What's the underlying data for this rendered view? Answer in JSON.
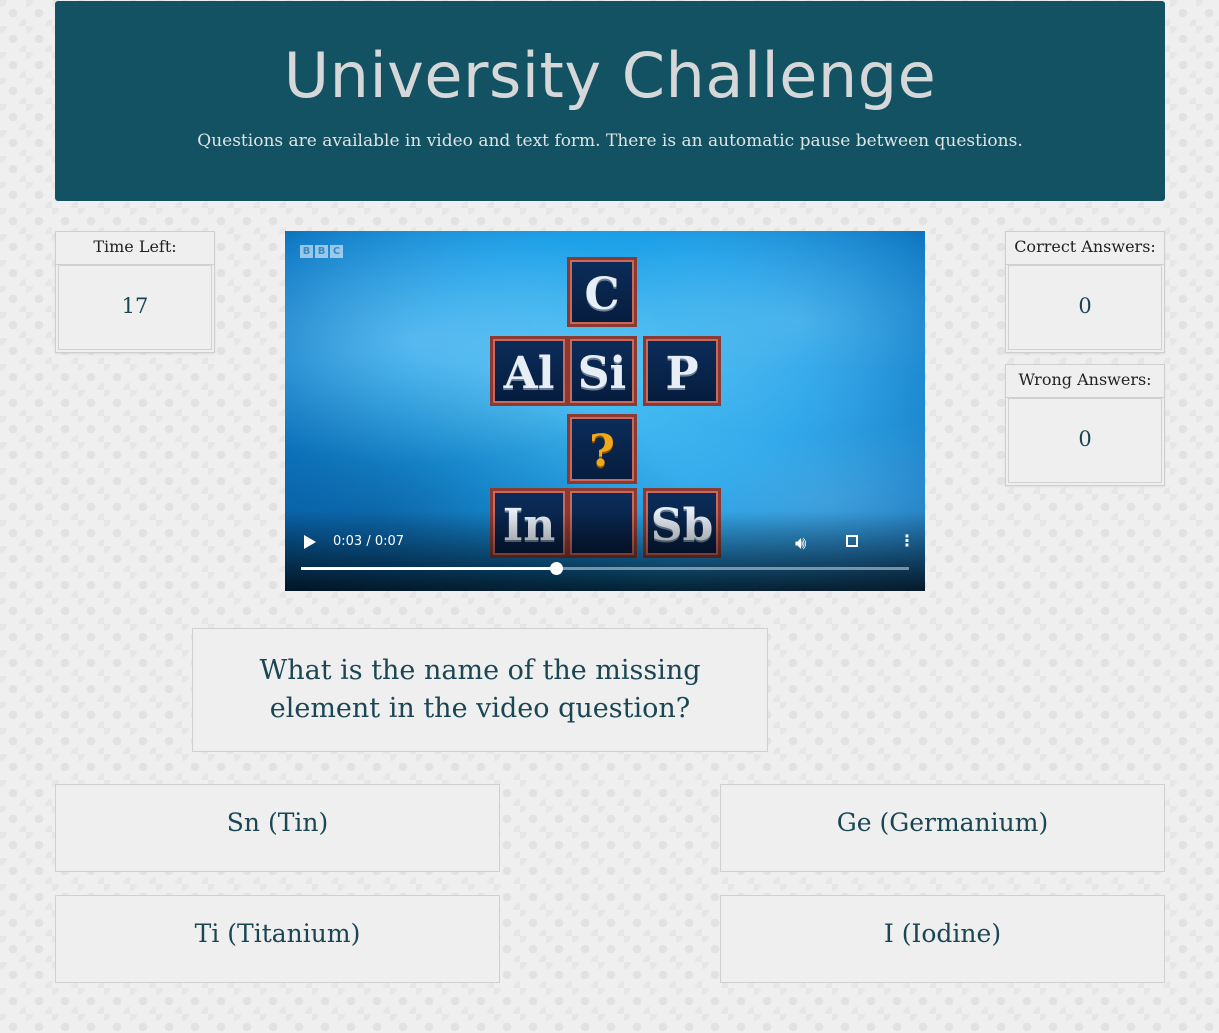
{
  "header": {
    "title": "University Challenge",
    "subtitle": "Questions are available in video and text form. There is an automatic pause between questions."
  },
  "stats": {
    "time_left_label": "Time Left:",
    "time_left_value": "17",
    "correct_label": "Correct Answers:",
    "correct_value": "0",
    "wrong_label": "Wrong Answers:",
    "wrong_value": "0"
  },
  "video": {
    "logo_letters": [
      "B",
      "B",
      "C"
    ],
    "tiles": [
      "C",
      "Al",
      "Si",
      "P",
      "?",
      "In",
      "Sb"
    ],
    "time_display": "0:03 / 0:07",
    "progress_fraction": 0.42
  },
  "question": {
    "text": "What is the name of the missing element in the video question?"
  },
  "answers": [
    "Sn (Tin)",
    "Ge (Germanium)",
    "Ti (Titanium)",
    "I (Iodine)"
  ],
  "colors": {
    "header_bg": "#135262",
    "text_accent": "#1a4654"
  }
}
